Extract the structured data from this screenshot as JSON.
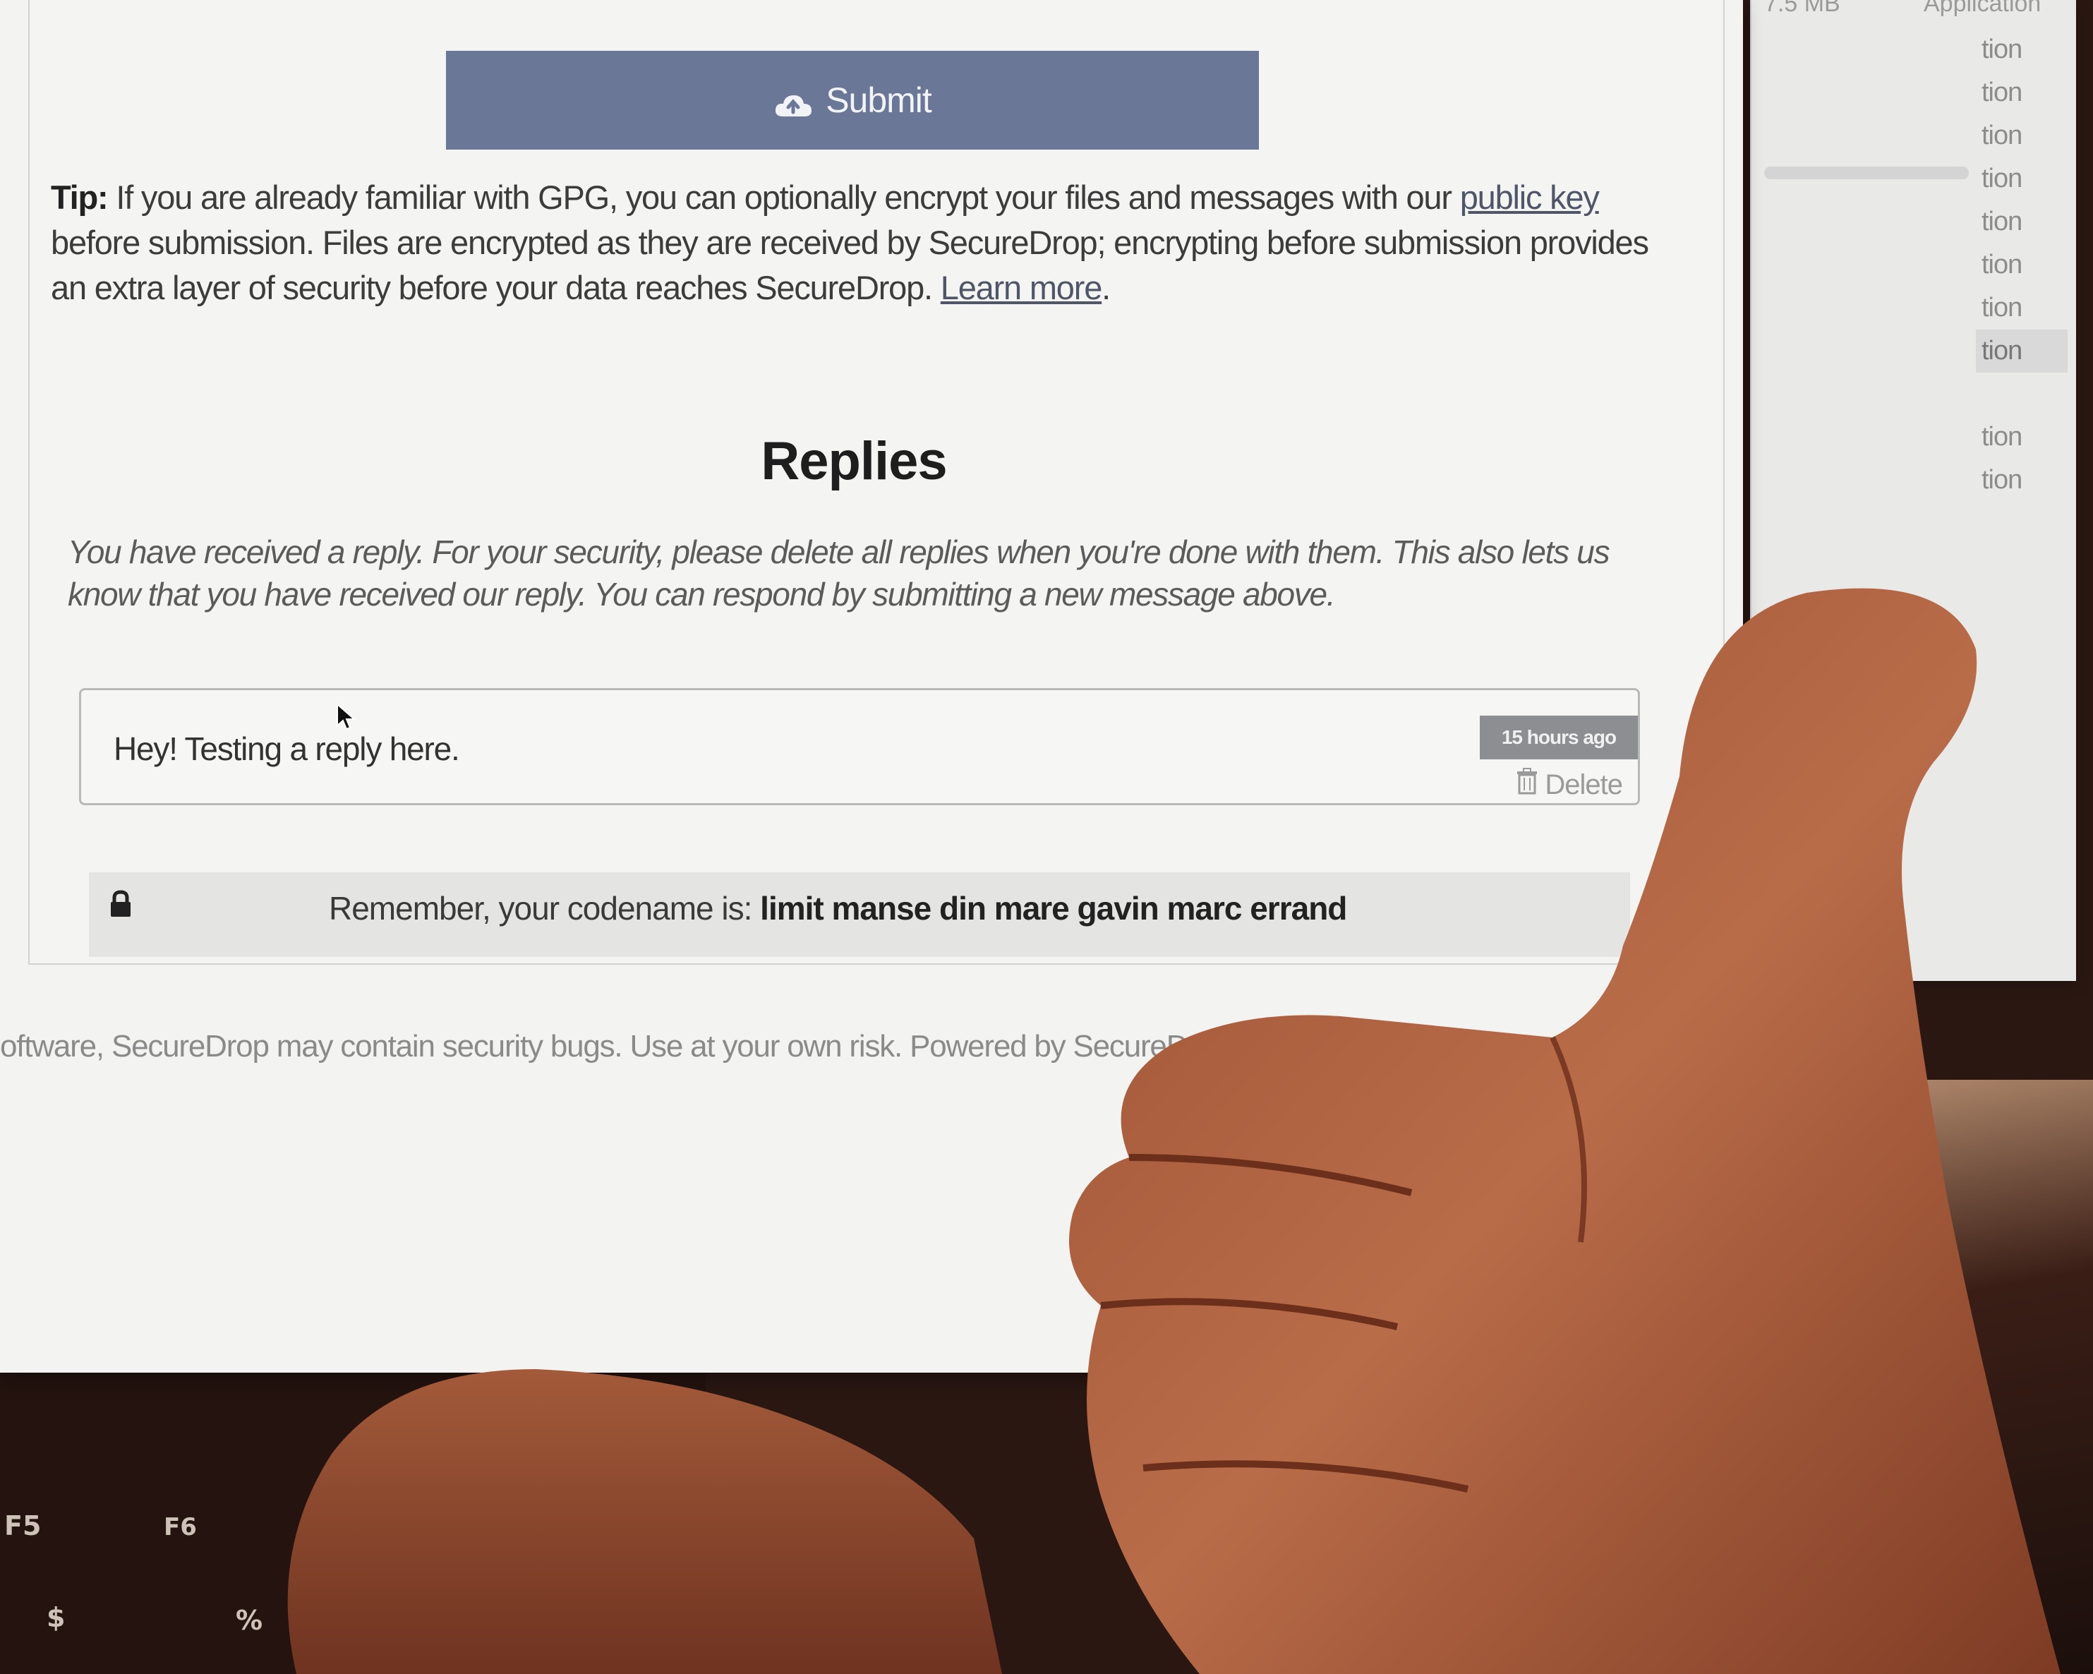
{
  "background_window": {
    "header_size": "7.5 MB",
    "header_kind": "Application",
    "rows": [
      "tion",
      "tion",
      "tion",
      "tion",
      "tion",
      "tion",
      "tion",
      "tion",
      "",
      "tion",
      "tion"
    ]
  },
  "submit": {
    "label": "Submit",
    "icon": "cloud-upload-icon"
  },
  "tip": {
    "label": "Tip:",
    "text_1": " If you are already familiar with GPG, you can optionally encrypt your files and messages with our ",
    "link_public_key": "public key",
    "text_2": " before submission. Files are encrypted as they are received by SecureDrop; encrypting before submission provides an extra layer of security before your data reaches SecureDrop. ",
    "link_learn_more": "Learn more",
    "text_3": "."
  },
  "replies": {
    "title": "Replies",
    "note": "You have received a reply. For your security, please delete all replies when you're done with them. This also lets us know that you have received our reply. You can respond by submitting a new message above.",
    "items": [
      {
        "text": "Hey! Testing a reply here.",
        "time": "15 hours ago",
        "delete_label": "Delete"
      }
    ]
  },
  "codename": {
    "prefix": "Remember, your codename is: ",
    "value": "limit manse din mare gavin marc errand"
  },
  "footer": {
    "text": "oftware, SecureDrop may contain security bugs. Use at your own risk. Powered by SecureDrop 0.3.10."
  },
  "keyboard": {
    "keys": [
      "F5",
      "F6",
      "$",
      "%"
    ]
  },
  "colors": {
    "submit_bg": "#6b7797",
    "page_bg": "#f3f4f2",
    "skin": "#b8704e"
  }
}
